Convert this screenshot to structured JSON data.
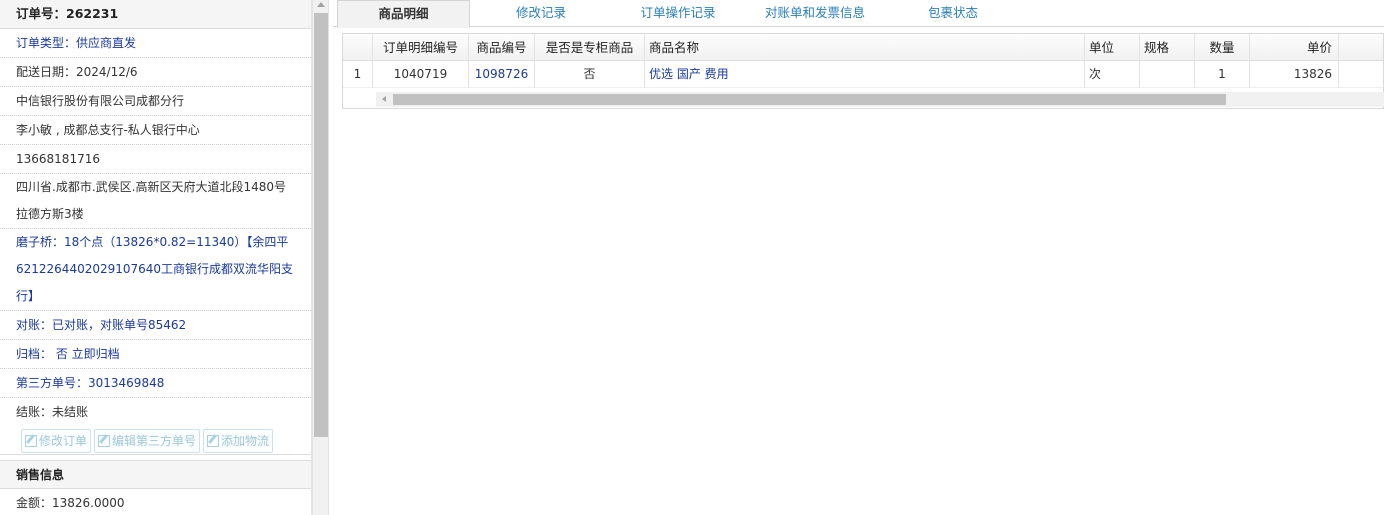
{
  "order": {
    "header": "订单号：262231",
    "type": "订单类型：供应商直发",
    "delivery_date": "配送日期：2024/12/6",
    "company": "中信银行股份有限公司成都分行",
    "contact": "李小敏 , 成都总支行-私人银行中心",
    "phone": "13668181716",
    "address": "四川省.成都市.武侯区.高新区天府大道北段1480号拉德方斯3楼",
    "note": "磨子桥：18个点（13826*0.82=11340）【余四平6212264402029107640工商银行成都双流华阳支行】",
    "reconcile": "对账：已对账，对账单号85462",
    "archive": "归档： 否 立即归档",
    "third_party": "第三方单号：3013469848",
    "settle": "结账：未结账"
  },
  "buttons": {
    "edit_order": "修改订单",
    "edit_third_party": "编辑第三方单号",
    "add_logistics": "添加物流"
  },
  "sales": {
    "title": "销售信息",
    "amount": "金额：13826.0000"
  },
  "tabs": [
    "商品明细",
    "修改记录",
    "订单操作记录",
    "对账单和发票信息",
    "包裹状态"
  ],
  "grid": {
    "headers": [
      "订单明细编号",
      "商品编号",
      "是否是专柜商品",
      "商品名称",
      "单位",
      "规格",
      "数量",
      "单价"
    ],
    "rows": [
      {
        "index": "1",
        "detail_id": "1040719",
        "product_id": "1098726",
        "counter": "否",
        "name": "优选 国产 费用",
        "unit": "次",
        "spec": "",
        "qty": "1",
        "price": "13826"
      }
    ]
  },
  "colors": {
    "link": "#1a3a9c",
    "tab_link": "#2a7fb8",
    "disabled_button": "#9ec8da"
  }
}
